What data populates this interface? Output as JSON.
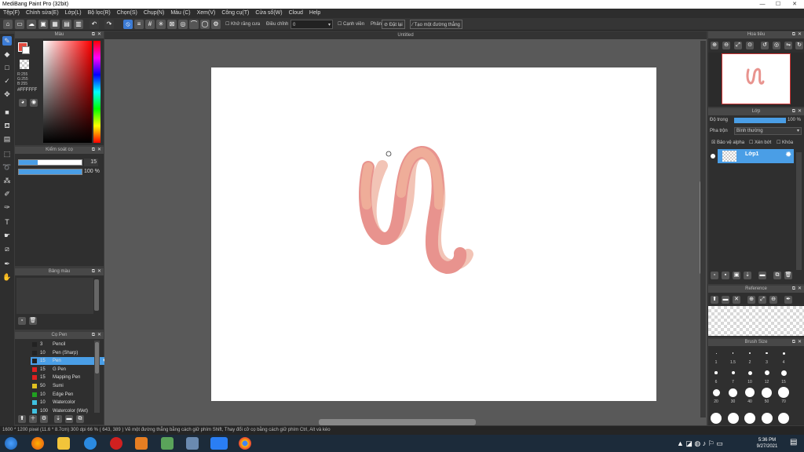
{
  "window": {
    "title": "MediBang Paint Pro (32bit)",
    "minimize": "—",
    "maximize": "☐",
    "close": "✕"
  },
  "menu": [
    "Tệp(F)",
    "Chỉnh sửa(E)",
    "Lớp(L)",
    "Bộ lọc(R)",
    "Chọn(S)",
    "Chụp(N)",
    "Màu (C)",
    "Xem(V)",
    "Công cụ(T)",
    "Cửa sổ(W)",
    "Cloud",
    "Help"
  ],
  "toolbar": {
    "anti_alias": "Khử răng cưa",
    "correction_label": "Điều chỉnh",
    "correction_value": "0",
    "edge": "Cạnh viền",
    "snap_label": "Phân",
    "snap_off": "Đặt lại",
    "create_line": "Tạo một đường thẳng"
  },
  "document": {
    "tab": "Untitled"
  },
  "color_panel": {
    "title": "Màu",
    "r": "R:255",
    "g": "G:255",
    "b": "B:255",
    "hex": "#FFFFFF"
  },
  "brush_control": {
    "title": "Kiểm soát cọ",
    "size": "15",
    "opacity": "100 %"
  },
  "palette": {
    "title": "Bảng màu"
  },
  "brush_panel": {
    "title": "Cọ Pen",
    "items": [
      {
        "size": "3",
        "name": "Pencil",
        "color": "#222222"
      },
      {
        "size": "10",
        "name": "Pen (Sharp)",
        "color": "#222222"
      },
      {
        "size": "15",
        "name": "Pen",
        "color": "#222222"
      },
      {
        "size": "15",
        "name": "G Pen",
        "color": "#e02020"
      },
      {
        "size": "15",
        "name": "Mapping Pen",
        "color": "#e02020"
      },
      {
        "size": "50",
        "name": "Sumi",
        "color": "#e0c020"
      },
      {
        "size": "10",
        "name": "Edge Pen",
        "color": "#20a020"
      },
      {
        "size": "10",
        "name": "Watercolor",
        "color": "#40c0e0"
      },
      {
        "size": "100",
        "name": "Watercolor (Wet)",
        "color": "#40c0e0"
      }
    ]
  },
  "navigator": {
    "title": "Hoa tiêu"
  },
  "layer_panel": {
    "title": "Lớp",
    "opacity_label": "Độ trong",
    "opacity_value": "100 %",
    "blend_label": "Pha trộn",
    "blend_value": "Bình thường",
    "protect_alpha": "Bảo vệ alpha",
    "clipping": "Xén bớt",
    "lock": "Khóa",
    "layers": [
      {
        "name": "Lớp1"
      }
    ]
  },
  "reference": {
    "title": "Reference"
  },
  "brush_size": {
    "title": "Brush Size",
    "labels": [
      "1",
      "1.5",
      "2",
      "3",
      "4",
      "6",
      "7",
      "10",
      "12",
      "15",
      "20",
      "30",
      "40",
      "50",
      "70"
    ]
  },
  "status": {
    "text": "1600 * 1200 pixel  (11.6 * 8.7cm)  300 dpi  66 %  ( 643, 389 )  Vẽ một đường thẳng bằng cách giữ phím Shift, Thay đổi cỡ cọ bằng cách giữ phím Ctrl, Alt và kéo"
  },
  "taskbar": {
    "time": "5:36 PM",
    "date": "9/27/2021"
  },
  "colors": {
    "stroke_main": "#e8938e",
    "stroke_light": "#f2c4b6",
    "accent": "#4a9ee6"
  }
}
